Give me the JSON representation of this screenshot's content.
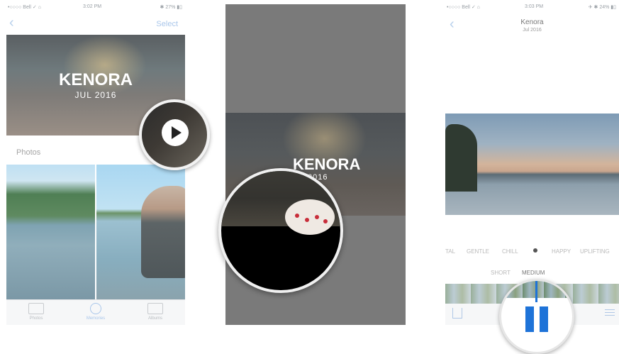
{
  "panel1": {
    "status": {
      "carrier": "•○○○○ Bell ✓ ⌂",
      "time": "3:02 PM",
      "battery": "✱ 27% ▮▯"
    },
    "nav": {
      "back": "‹",
      "select": "Select"
    },
    "memory": {
      "title": "KENORA",
      "subtitle": "JUL 2016"
    },
    "section_label": "Photos",
    "tabs": [
      {
        "label": "Photos"
      },
      {
        "label": "Memories"
      },
      {
        "label": "Albums"
      }
    ]
  },
  "panel2": {
    "memory": {
      "title": "KENORA",
      "subtitle": "2016"
    }
  },
  "panel3": {
    "status": {
      "carrier": "•○○○○ Bell ✓ ⌂",
      "time": "3:03 PM",
      "battery": "✈ ✱ 24% ▮▯"
    },
    "nav": {
      "back": "‹",
      "title": "Kenora",
      "date": "Jul 2016"
    },
    "moods": [
      "TAL",
      "GENTLE",
      "CHILL",
      "HAPPY",
      "UPLIFTING"
    ],
    "lengths": [
      "SHORT",
      "MEDIUM"
    ],
    "selected_length": "MEDIUM"
  },
  "colors": {
    "accent": "#1e73d8",
    "nav_tint": "#a9c6ea"
  },
  "icons": [
    "play-icon",
    "pause-icon",
    "share-icon",
    "adjust-icon",
    "photos-tab-icon",
    "memories-tab-icon",
    "albums-tab-icon"
  ]
}
